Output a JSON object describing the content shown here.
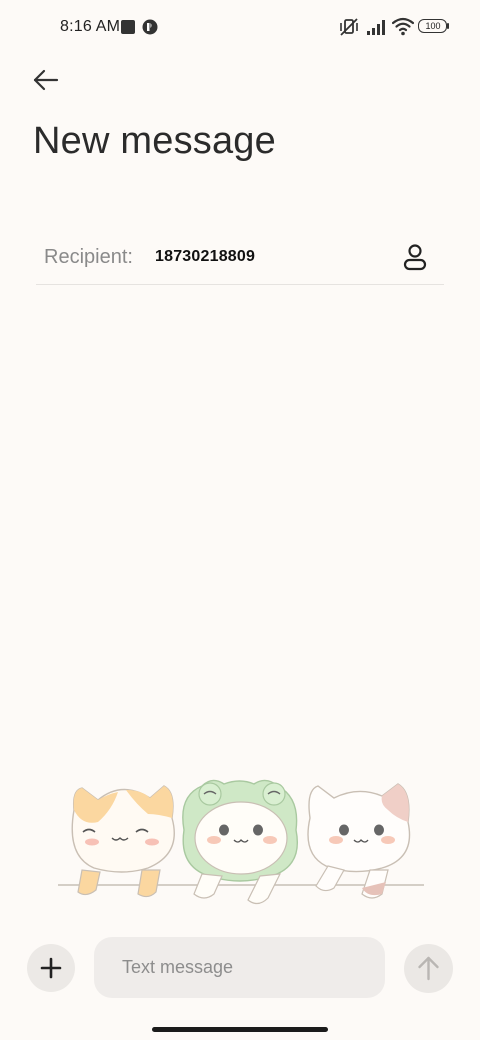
{
  "status_bar": {
    "time": "8:16 AM",
    "battery": "100",
    "icons": [
      "notification-square-icon",
      "app-notification-icon",
      "vibrate-off-icon",
      "signal-icon",
      "wifi-icon",
      "battery-icon"
    ]
  },
  "header": {
    "back_icon": "arrow-left-icon",
    "title": "New message"
  },
  "recipient": {
    "label": "Recipient:",
    "value": "18730218809",
    "contact_icon": "person-icon"
  },
  "illustration": {
    "description_icons": [
      "orange-cat",
      "frog-hat-cat",
      "calico-cat"
    ]
  },
  "composer": {
    "add_icon": "plus-icon",
    "placeholder": "Text message",
    "send_icon": "arrow-up-icon"
  },
  "colors": {
    "background": "#fdfaf7",
    "input_bg": "#efecea",
    "muted_text": "#8a8a8a"
  }
}
